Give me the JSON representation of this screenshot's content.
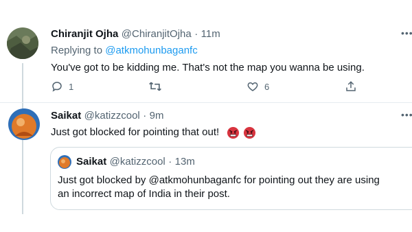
{
  "tweet1": {
    "name": "Chiranjit Ojha",
    "handle": "@ChiranjitOjha",
    "time": "11m",
    "replying_prefix": "Replying to",
    "replying_to": "@atkmohunbaganfc",
    "text": "You've got to be kidding me. That's not the map you wanna be using.",
    "reply_count": "1",
    "like_count": "6"
  },
  "tweet2": {
    "name": "Saikat",
    "handle": "@katizzcool",
    "time": "9m",
    "text": "Just got blocked for pointing that out!",
    "emojis": [
      "angry-face",
      "angry-face"
    ]
  },
  "quoted": {
    "name": "Saikat",
    "handle": "@katizzcool",
    "time": "13m",
    "text_before": "Just got blocked by",
    "mention": "@atkmohunbaganfc",
    "text_after": "for pointing out they are using",
    "text_line2": "an incorrect map of India in their post."
  },
  "separator": "·",
  "colors": {
    "link": "#1d9bf0",
    "muted": "#536471",
    "text": "#0f1419",
    "thread_line": "#cfd9de"
  }
}
